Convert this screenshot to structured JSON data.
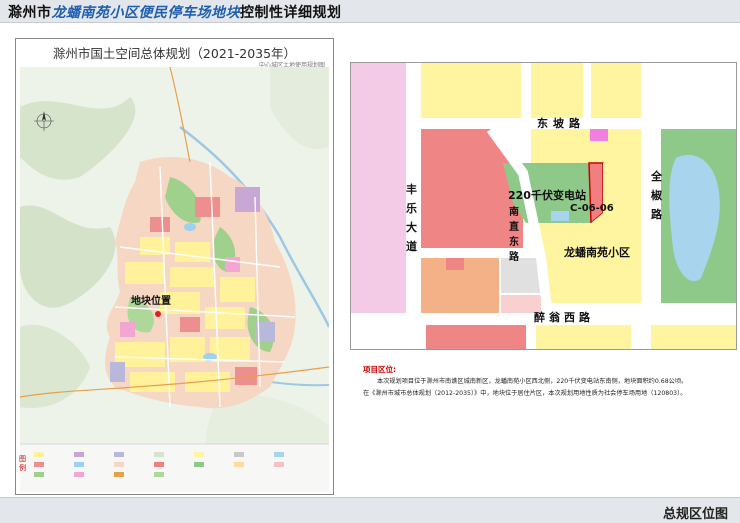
{
  "header": {
    "prefix": "滁州市",
    "highlight": "龙蟠南苑小区便民停车场地块",
    "suffix": "控制性详细规划"
  },
  "left_map": {
    "title": "滁州市国土空间总体规划（2021-2035年）",
    "subtitle": "中心城区土地使用规划图",
    "location_label": "地块位置",
    "legend_caption": "图例"
  },
  "right_map": {
    "roads": {
      "dongpo": "东坡路",
      "fengle": "丰乐大道",
      "nanzhi": "南直东路",
      "zuiweng": "醉翁西路",
      "quanjiao": "全椒路"
    },
    "substation": "220千伏变电站",
    "parcel_code": "C-06-06",
    "community": "龙蟠南苑小区"
  },
  "info": {
    "heading": "项目区位:",
    "line1": "本次规划项目位于滁州市南谯区城南新区，龙蟠南苑小区西北侧，220千伏变电站东南侧，地块面积约0.68公顷。",
    "line2": "在《滁州市城市总体规划（2012-2035）》中，地块位于居住片区，本次规划用地性质为社会停车场用地（120803）。"
  },
  "footer": {
    "title": "总规区位图"
  },
  "colors": {
    "residential": "#fff5a0",
    "commercial": "#f08080",
    "green": "#8fc98a",
    "water": "#a8d4ee",
    "road": "#ffffff",
    "highlight": "#1f5fb0"
  }
}
